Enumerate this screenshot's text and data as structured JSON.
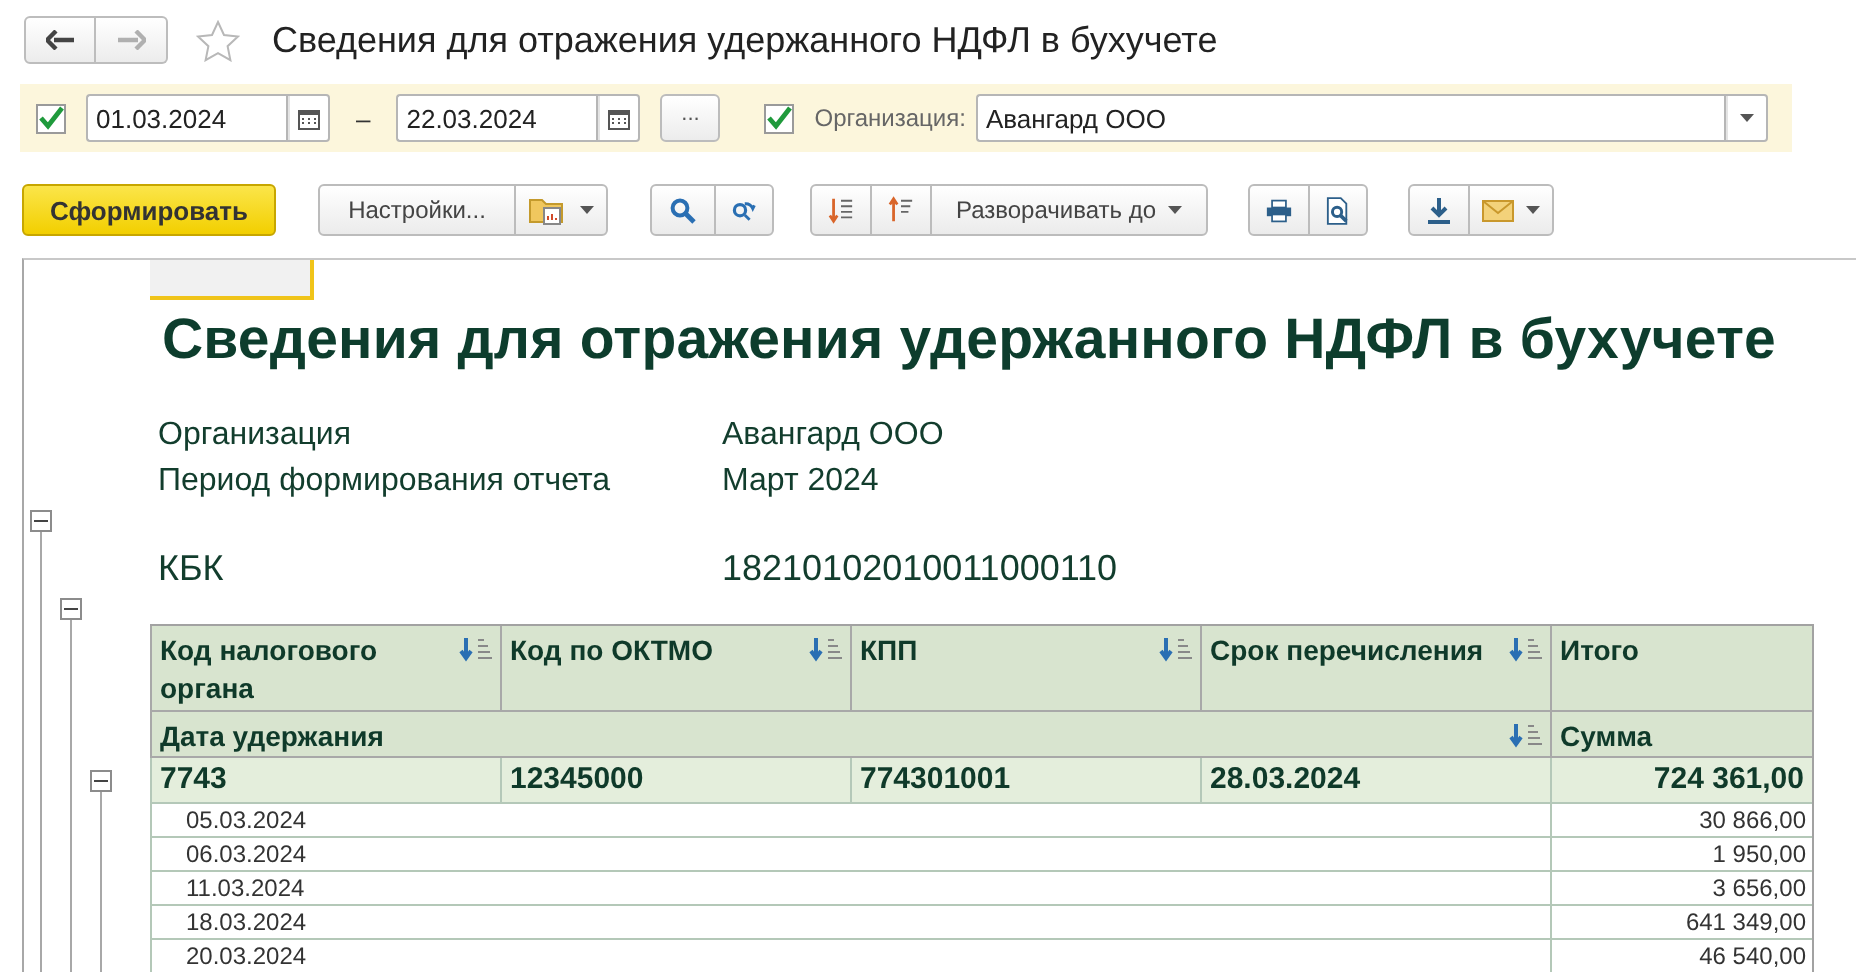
{
  "navigation": {
    "back": {
      "disabled": false
    },
    "forward": {
      "disabled": true
    }
  },
  "window": {
    "title": "Сведения для отражения удержанного НДФЛ в бухучете",
    "favorite": false
  },
  "filters": {
    "period": {
      "checked": true,
      "from": "01.03.2024",
      "separator": "–",
      "to": "22.03.2024",
      "more_button": "..."
    },
    "organization": {
      "checked": true,
      "label": "Организация:",
      "value": "Авангард ООО"
    }
  },
  "toolbar": {
    "generate_button": "Сформировать",
    "settings_button": "Настройки...",
    "expand_button": "Разворачивать до"
  },
  "report": {
    "expanded": true,
    "title": "Сведения для отражения удержанного НДФЛ в бухучете",
    "info": [
      {
        "label": "Организация",
        "value": "Авангард ООО"
      },
      {
        "label": "Период формирования отчета",
        "value": "Март 2024"
      }
    ],
    "kbk": {
      "expanded": true,
      "label": "КБК",
      "value": "18210102010011000110"
    },
    "table": {
      "columns": [
        {
          "label": "Код налогового органа",
          "sortable": true
        },
        {
          "label": "Код по ОКТМО",
          "sortable": true
        },
        {
          "label": "КПП",
          "sortable": true
        },
        {
          "label": "Срок перечисления",
          "sortable": true
        },
        {
          "label": "Итого",
          "sortable": false
        }
      ],
      "subheader": {
        "label": "Дата удержания",
        "sortable": true,
        "total_label": "Сумма"
      },
      "group": {
        "expanded": true,
        "cells": [
          "7743",
          "12345000",
          "774301001",
          "28.03.2024"
        ],
        "total": "724 361,00"
      },
      "rows": [
        {
          "date": "05.03.2024",
          "amount": "30 866,00"
        },
        {
          "date": "06.03.2024",
          "amount": "1 950,00"
        },
        {
          "date": "11.03.2024",
          "amount": "3 656,00"
        },
        {
          "date": "18.03.2024",
          "amount": "641 349,00"
        },
        {
          "date": "20.03.2024",
          "amount": "46 540,00"
        }
      ]
    }
  }
}
